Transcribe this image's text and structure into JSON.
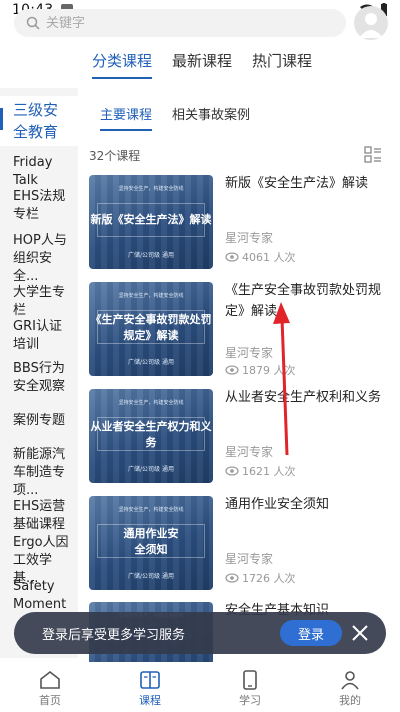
{
  "status": {
    "time": "10:43"
  },
  "search": {
    "placeholder": "关键字"
  },
  "main_tabs": [
    {
      "label": "分类课程",
      "active": true
    },
    {
      "label": "最新课程",
      "active": false
    },
    {
      "label": "热门课程",
      "active": false
    }
  ],
  "sidebar": {
    "items": [
      {
        "label": "三级安全教育",
        "active": true
      },
      {
        "label": "Friday Talk"
      },
      {
        "label": "EHS法规专栏"
      },
      {
        "label": "HOP人与组织安全..."
      },
      {
        "label": "大学生专栏"
      },
      {
        "label": "GRI认证培训"
      },
      {
        "label": "BBS行为安全观察"
      },
      {
        "label": "案例专题"
      },
      {
        "label": "新能源汽车制造专项..."
      },
      {
        "label": "EHS运营基础课程"
      },
      {
        "label": "Ergo人因工效学基..."
      },
      {
        "label": "Safety Moment"
      }
    ]
  },
  "sub_tabs": [
    {
      "label": "主要课程",
      "active": true
    },
    {
      "label": "相关事故案例",
      "active": false
    }
  ],
  "course_count": "32个课程",
  "courses": [
    {
      "title": "新版《安全生产法》解读",
      "thumb_title": "新版《安全生产法》解读",
      "author": "星河专家",
      "views": "4061 人次"
    },
    {
      "title": "《生产安全事故罚款处罚规定》解读",
      "thumb_title": "《生产安全事故罚款处罚规定》解读",
      "author": "星河专家",
      "views": "1879 人次"
    },
    {
      "title": "从业者安全生产权利和义务",
      "thumb_title": "从业者安全生产权力和义务",
      "author": "星河专家",
      "views": "1621 人次"
    },
    {
      "title": "通用作业安全须知",
      "thumb_title": "通用作业安全须知",
      "author": "星河专家",
      "views": "1726 人次"
    },
    {
      "title": "安全生产基本知识",
      "thumb_title": "",
      "author": "",
      "views": ""
    }
  ],
  "thumb_text": {
    "tag": "坚持安全生产，构建安全防线",
    "footer": "广储/公司级 通用"
  },
  "login_banner": {
    "text": "登录后享受更多学习服务",
    "button": "登录"
  },
  "bottom_nav": [
    {
      "label": "首页",
      "icon": "home-icon",
      "active": false
    },
    {
      "label": "课程",
      "icon": "book-icon",
      "active": true
    },
    {
      "label": "学习",
      "icon": "tablet-icon",
      "active": false
    },
    {
      "label": "我的",
      "icon": "person-icon",
      "active": false
    }
  ],
  "colors": {
    "accent": "#2160b8",
    "banner": "#343b4c",
    "login_button": "#2f6fd3",
    "annotation": "#e0242a"
  }
}
